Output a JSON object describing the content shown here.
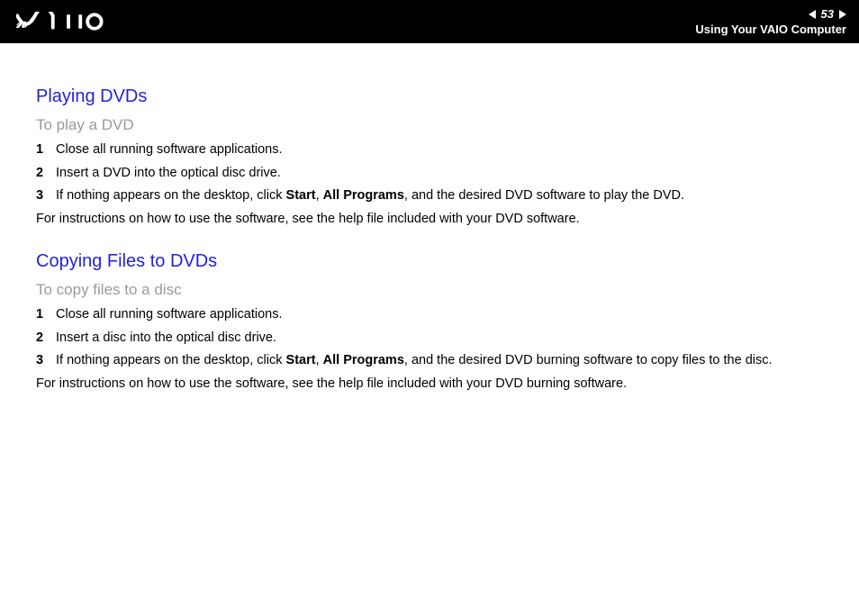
{
  "header": {
    "page_number": "53",
    "section": "Using Your VAIO Computer"
  },
  "sections": [
    {
      "title": "Playing DVDs",
      "subtitle": "To play a DVD",
      "steps": [
        {
          "n": "1",
          "text": "Close all running software applications."
        },
        {
          "n": "2",
          "text": "Insert a DVD into the optical disc drive."
        },
        {
          "n": "3",
          "prefix": "If nothing appears on the desktop, click ",
          "b1": "Start",
          "mid1": ", ",
          "b2": "All Programs",
          "suffix": ", and the desired DVD software to play the DVD."
        }
      ],
      "footer": "For instructions on how to use the software, see the help file included with your DVD software."
    },
    {
      "title": "Copying Files to DVDs",
      "subtitle": "To copy files to a disc",
      "steps": [
        {
          "n": "1",
          "text": "Close all running software applications."
        },
        {
          "n": "2",
          "text": "Insert a disc into the optical disc drive."
        },
        {
          "n": "3",
          "prefix": "If nothing appears on the desktop, click ",
          "b1": "Start",
          "mid1": ", ",
          "b2": "All Programs",
          "suffix": ", and the desired DVD burning software to copy files to the disc."
        }
      ],
      "footer": "For instructions on how to use the software, see the help file included with your DVD burning software."
    }
  ]
}
